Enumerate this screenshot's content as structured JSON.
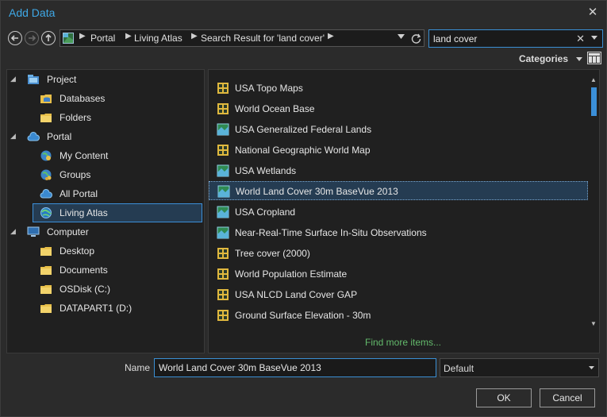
{
  "window": {
    "title": "Add Data",
    "close_glyph": "✕"
  },
  "navigation": {
    "breadcrumbs": [
      "Portal",
      "Living Atlas",
      "Search Result for 'land cover'"
    ],
    "separator": "▶"
  },
  "search": {
    "value": "land cover",
    "clear_glyph": "✕"
  },
  "toolbar": {
    "categories_label": "Categories"
  },
  "tree": {
    "items": [
      {
        "label": "Project",
        "icon": "project-icon",
        "level": 0,
        "expander": "◢"
      },
      {
        "label": "Databases",
        "icon": "database-folder-icon",
        "level": 1
      },
      {
        "label": "Folders",
        "icon": "folder-icon",
        "level": 1
      },
      {
        "label": "Portal",
        "icon": "cloud-icon",
        "level": 0,
        "expander": "◢"
      },
      {
        "label": "My Content",
        "icon": "user-globe-icon",
        "level": 1
      },
      {
        "label": "Groups",
        "icon": "group-globe-icon",
        "level": 1
      },
      {
        "label": "All Portal",
        "icon": "cloud-small-icon",
        "level": 1
      },
      {
        "label": "Living Atlas",
        "icon": "living-atlas-icon",
        "level": 1,
        "selected": true
      },
      {
        "label": "Computer",
        "icon": "computer-icon",
        "level": 0,
        "expander": "◢"
      },
      {
        "label": "Desktop",
        "icon": "folder-icon",
        "level": 1
      },
      {
        "label": "Documents",
        "icon": "folder-icon",
        "level": 1
      },
      {
        "label": "OSDisk (C:)",
        "icon": "folder-icon",
        "level": 1
      },
      {
        "label": "DATAPART1 (D:)",
        "icon": "folder-icon",
        "level": 1
      }
    ]
  },
  "results": {
    "items": [
      {
        "label": "USA Topo Maps",
        "icon": "tile-layer-icon"
      },
      {
        "label": "World Ocean Base",
        "icon": "tile-layer-icon"
      },
      {
        "label": "USA Generalized Federal Lands",
        "icon": "map-layer-icon"
      },
      {
        "label": "National Geographic World Map",
        "icon": "tile-layer-icon"
      },
      {
        "label": "USA Wetlands",
        "icon": "map-layer-icon"
      },
      {
        "label": "World Land Cover 30m BaseVue 2013",
        "icon": "map-layer-icon",
        "selected": true
      },
      {
        "label": "USA Cropland",
        "icon": "map-layer-icon"
      },
      {
        "label": "Near-Real-Time Surface In-Situ Observations",
        "icon": "map-layer-icon"
      },
      {
        "label": "Tree cover (2000)",
        "icon": "tile-layer-icon"
      },
      {
        "label": "World Population Estimate",
        "icon": "tile-layer-icon"
      },
      {
        "label": "USA NLCD Land Cover GAP",
        "icon": "tile-layer-icon"
      },
      {
        "label": "Ground Surface Elevation - 30m",
        "icon": "tile-layer-icon"
      }
    ],
    "find_more": "Find more items..."
  },
  "footer": {
    "name_label": "Name",
    "name_value": "World Land Cover 30m BaseVue 2013",
    "type_value": "Default",
    "ok_label": "OK",
    "cancel_label": "Cancel"
  },
  "colors": {
    "accent": "#3fa8e6",
    "selection": "#253c52",
    "link": "#63b96b",
    "folder": "#e8c04a"
  }
}
